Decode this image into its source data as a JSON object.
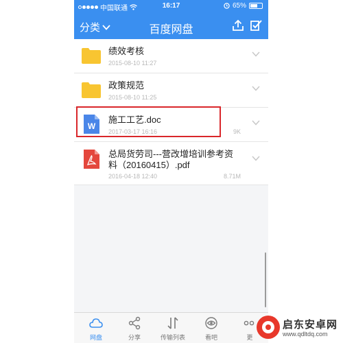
{
  "status_bar": {
    "carrier": "中国联通",
    "time": "16:17",
    "battery": "65%"
  },
  "nav": {
    "category_label": "分类",
    "title": "百度网盘"
  },
  "files": [
    {
      "name": "绩效考核",
      "type": "folder",
      "date": "2015-08-10 11:27",
      "size": ""
    },
    {
      "name": "政策规范",
      "type": "folder",
      "date": "2015-08-10 11:25",
      "size": ""
    },
    {
      "name": "施工工艺.doc",
      "type": "doc",
      "icon_letter": "W",
      "date": "2017-03-17 16:16",
      "size": "9K"
    },
    {
      "name": "总局货劳司---营改增培训参考资料（20160415）.pdf",
      "type": "pdf",
      "date": "2016-04-18 12:40",
      "size": "8.71M"
    }
  ],
  "tabs": [
    {
      "label": "网盘",
      "active": true
    },
    {
      "label": "分享",
      "active": false
    },
    {
      "label": "传输列表",
      "active": false
    },
    {
      "label": "看吧",
      "active": false
    },
    {
      "label": "更",
      "active": false
    }
  ],
  "watermark": {
    "name": "启东安卓网",
    "url": "www.qdltdq.com"
  },
  "colors": {
    "accent": "#3a8ff0",
    "highlight": "#d9262a",
    "folder": "#f8c531",
    "doc": "#4a86e8",
    "pdf": "#e4473d"
  }
}
